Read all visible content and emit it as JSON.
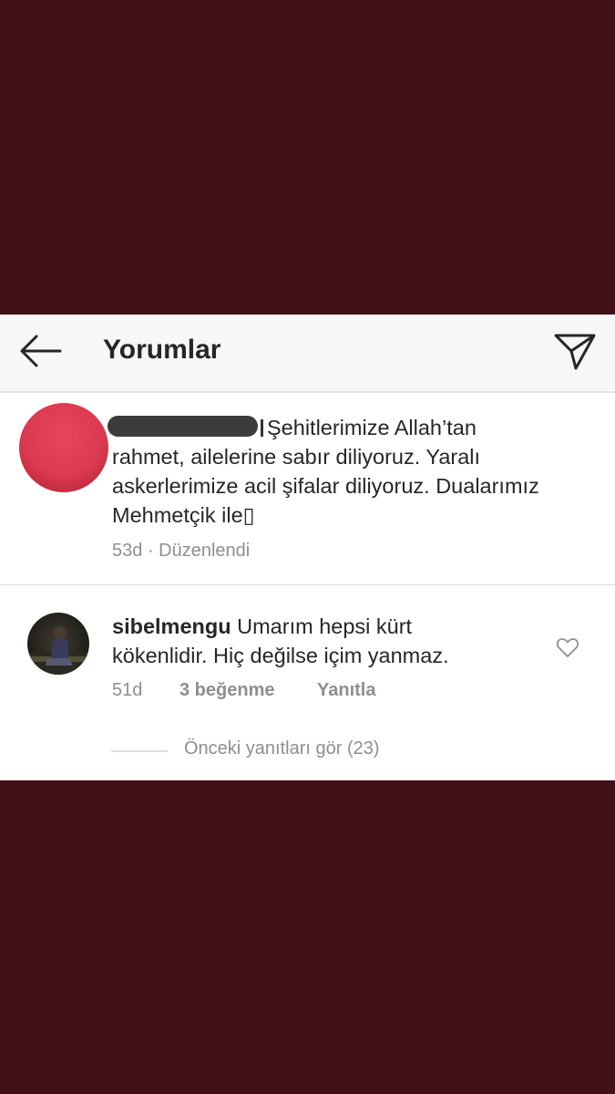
{
  "header": {
    "title": "Yorumlar",
    "back_icon": "arrow-left-icon",
    "send_icon": "paper-plane-icon"
  },
  "comments": [
    {
      "username": "",
      "text_line1": "Şehitlerimize Allah’tan",
      "text_rest": "rahmet, ailelerine sabır diliyoruz. Yaralı askerlerimize acil şifalar diliyoruz. Dualarımız Mehmetçik ile",
      "missing_glyph": "▯",
      "time": "53d",
      "separator": "·",
      "edited": "Düzenlendi",
      "avatar_color": "#dc3a50"
    },
    {
      "username": "sibelmengu",
      "text": "Umarım hepsi kürt kökenlidir. Hiç değilse içim yanmaz.",
      "time": "51d",
      "likes": "3 beğenme",
      "reply": "Yanıtla",
      "heart_icon": "heart-outline-icon"
    }
  ],
  "view_previous_replies": "Önceki yanıtları gör (23)",
  "colors": {
    "background": "#421018",
    "header_bg": "#f7f7f7",
    "text": "#262626",
    "meta": "#8e8e8e"
  }
}
